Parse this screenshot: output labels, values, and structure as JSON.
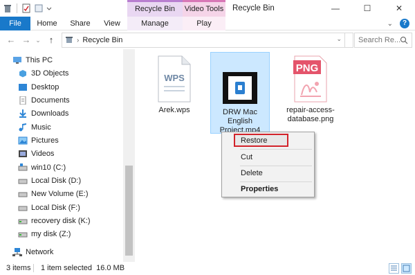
{
  "window": {
    "title": "Recycle Bin",
    "tool_tabs": [
      "Recycle Bin Tools",
      "Video Tools"
    ],
    "controls": [
      "—",
      "☐",
      "✕"
    ]
  },
  "ribbon": {
    "tabs": [
      "File",
      "Home",
      "Share",
      "View",
      "Manage",
      "Play"
    ],
    "expand_glyph": "⌄",
    "help_glyph": "?"
  },
  "address": {
    "breadcrumb": "Recycle Bin",
    "search_placeholder": "Search Re..."
  },
  "nav": {
    "items": [
      {
        "label": "This PC",
        "icon": "computer-icon"
      },
      {
        "label": "3D Objects",
        "icon": "cube-icon"
      },
      {
        "label": "Desktop",
        "icon": "desktop-icon"
      },
      {
        "label": "Documents",
        "icon": "documents-icon"
      },
      {
        "label": "Downloads",
        "icon": "download-icon"
      },
      {
        "label": "Music",
        "icon": "music-icon"
      },
      {
        "label": "Pictures",
        "icon": "pictures-icon"
      },
      {
        "label": "Videos",
        "icon": "videos-icon"
      },
      {
        "label": "win10 (C:)",
        "icon": "drive-icon"
      },
      {
        "label": "Local Disk (D:)",
        "icon": "drive-icon"
      },
      {
        "label": "New Volume (E:)",
        "icon": "drive-icon"
      },
      {
        "label": "Local Disk (F:)",
        "icon": "drive-icon"
      },
      {
        "label": "recovery disk (K:)",
        "icon": "drive-icon"
      },
      {
        "label": "my disk (Z:)",
        "icon": "drive-icon"
      },
      {
        "label": "Network",
        "icon": "network-icon"
      }
    ]
  },
  "files": [
    {
      "name": "Arek.wps",
      "badge": "WPS",
      "icon": "wps-document-icon"
    },
    {
      "name": "DRW Mac English Project.mp4",
      "icon": "video-file-icon",
      "selected": true
    },
    {
      "name": "repair-access-database.png",
      "badge": "PNG",
      "icon": "png-image-icon"
    }
  ],
  "context_menu": {
    "items": [
      "Restore",
      "Cut",
      "Delete",
      "Properties"
    ],
    "highlight_color": "#d2232a"
  },
  "status": {
    "count": "3 items",
    "selection": "1 item selected  16.0 MB"
  },
  "colors": {
    "accent": "#1979ca",
    "selection": "#cce8ff",
    "recycle_tools": "#e9d7f2",
    "video_tools": "#f5d4e8"
  }
}
